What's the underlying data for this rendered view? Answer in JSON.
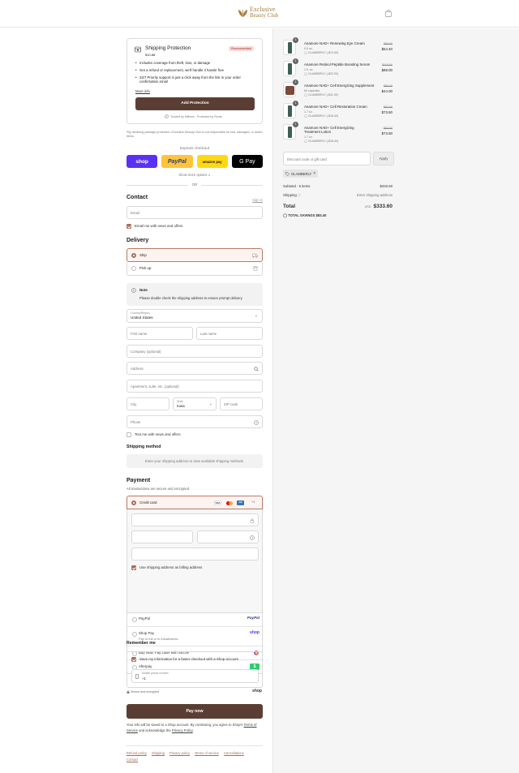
{
  "brand": {
    "line1": "Exclusive",
    "line2": "Beauty Club",
    "color": "#a87c3a"
  },
  "protection": {
    "title": "Shipping Protection",
    "price": "$10.88",
    "badge": "Recommended",
    "bullets": [
      "Includes coverage from theft, loss, or damage",
      "Get a refund or replacement, we'll handle it hassle free",
      "24/7 Priority support is just a click away from the link in your order confirmation email"
    ],
    "more": "More info",
    "button": "Add Protection",
    "trust": "Trusted by Millions · Protected by Route",
    "disclaimer": "*By declining package protection, Exclusive Beauty Club is not responsible for lost, damaged, or stolen items."
  },
  "express": {
    "title": "Express checkout",
    "buttons": [
      "shop",
      "PayPal",
      "amazon pay",
      "G Pay"
    ],
    "show_more": "Show more options ∨",
    "or": "OR"
  },
  "contact": {
    "heading": "Contact",
    "sign_in": "Sign in",
    "email_placeholder": "Email",
    "news_label": "Email me with news and offers"
  },
  "delivery": {
    "heading": "Delivery",
    "ship": "Ship",
    "pickup": "Pick up",
    "note_title": "Note",
    "note_text": "Please double check the shipping address to ensure prompt delivery",
    "country_label": "Country/Region",
    "country_value": "United States",
    "first_name": "First name",
    "last_name": "Last name",
    "company": "Company (optional)",
    "address": "Address",
    "apartment": "Apartment, suite, etc. (optional)",
    "city": "City",
    "state_label": "State",
    "state_value": "Iowa",
    "zip": "ZIP code",
    "phone": "Phone",
    "text_label": "Text me with news and offers"
  },
  "shipping_method": {
    "heading": "Shipping method",
    "message": "Enter your shipping address to view available shipping methods."
  },
  "payment": {
    "heading": "Payment",
    "subtitle": "All transactions are secure and encrypted.",
    "credit_card": "Credit card",
    "more_cards": "+1",
    "billing_label": "Use shipping address as billing address",
    "options": [
      {
        "label": "PayPal",
        "sub": "",
        "logo": "PayPal"
      },
      {
        "label": "Shop Pay",
        "sub": "Pay in full or in installments",
        "logo": "shop"
      },
      {
        "label": "Buy Now, Pay Later with Sezzle",
        "sub": "",
        "logo": "S"
      },
      {
        "label": "Afterpay",
        "sub": "",
        "logo": "$"
      }
    ]
  },
  "remember": {
    "heading": "Remember me",
    "save_label": "Save my information for a faster checkout with a Shop account",
    "phone_label": "Mobile phone number",
    "phone_value": "+1",
    "secure": "Secure and encrypted",
    "shop_logo": "shop"
  },
  "pay_now": "Pay now",
  "legal": {
    "before": "Your info will be saved to a Shop account. By continuing, you agree to Shop's",
    "terms": "Terms of Service",
    "middle": "and acknowledge the",
    "privacy": "Privacy Policy",
    "end": "."
  },
  "footer_links": [
    "Refund policy",
    "Shipping",
    "Privacy policy",
    "Terms of service",
    "Cancellations",
    "Contact"
  ],
  "cart": {
    "items": [
      {
        "qty": "1",
        "name": "Anamore NAD+ Renewing Eye Cream",
        "sub": "0.5 oz.",
        "discount": "GLAMBERLY (-$13.60)",
        "old": "$68.00",
        "price": "$54.40",
        "thumb": "tube"
      },
      {
        "qty": "1",
        "name": "Anamore Retinol Peptide Boosting Serum",
        "sub": "1 fl. oz.",
        "discount": "GLAMBERLY (-$22.00)",
        "old": "$110.00",
        "price": "$88.00",
        "thumb": "tube"
      },
      {
        "qty": "1",
        "name": "Anamore NAD+ Cell Energizing Supplement",
        "sub": "60 capsules",
        "discount": "GLAMBERLY (-$11.00)",
        "old": "$55.00",
        "price": "$44.00",
        "thumb": "jar"
      },
      {
        "qty": "1",
        "name": "Anamore NAD+ Cell Restoration Cream",
        "sub": "1.7 oz.",
        "discount": "GLAMBERLY (-$18.40)",
        "old": "$92.00",
        "price": "$73.60",
        "thumb": "tube"
      },
      {
        "qty": "1",
        "name": "Anamore NAD+ Cell Energizing Treatment Lotion",
        "sub": "1.7 oz.",
        "discount": "GLAMBERLY (-$18.40)",
        "old": "$92.00",
        "price": "$73.60",
        "thumb": "tube"
      }
    ],
    "discount_placeholder": "Discount code or gift card",
    "apply": "Apply",
    "code": "GLAMBERLY",
    "subtotal_label": "Subtotal · 5 items",
    "subtotal": "$333.60",
    "shipping_label": "Shipping",
    "shipping_value": "Enter shipping address",
    "total_label": "Total",
    "currency": "USD",
    "total": "$333.60",
    "savings_label": "TOTAL SAVINGS",
    "savings": "$83.40"
  },
  "colors": {
    "accent": "#a86d5a",
    "button": "#5b3e33",
    "shop": "#5a31f4",
    "paypal": "#ffc439",
    "amazon": "#ffd814"
  }
}
